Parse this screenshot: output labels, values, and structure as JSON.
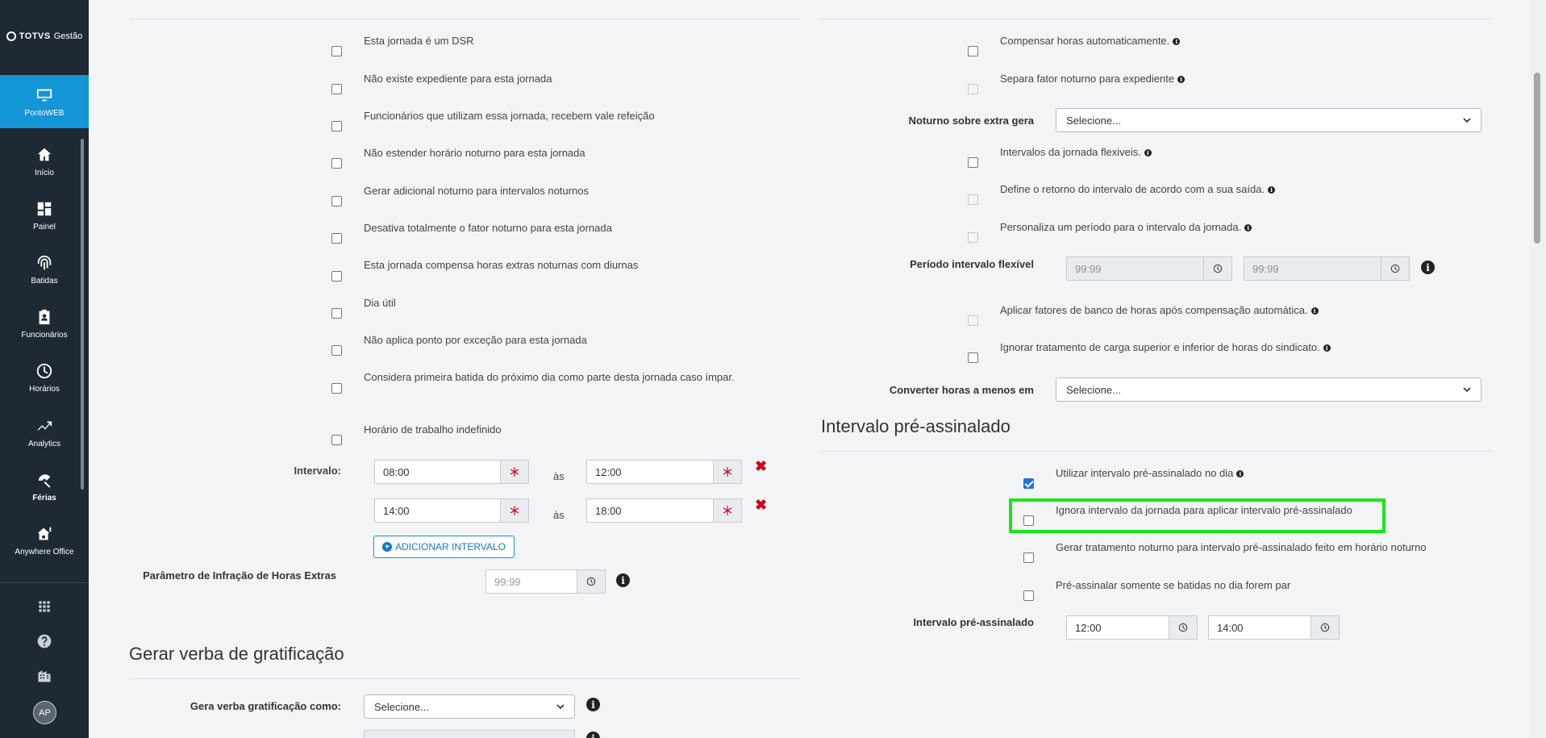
{
  "sidebar": {
    "logo_brand": "TOTVS",
    "logo_product": "Gestão",
    "items": [
      {
        "label": "PontoWEB",
        "icon": "monitor-icon"
      },
      {
        "label": "Início",
        "icon": "home-icon"
      },
      {
        "label": "Painel",
        "icon": "dashboard-icon"
      },
      {
        "label": "Batidas",
        "icon": "fingerprint-icon"
      },
      {
        "label": "Funcionários",
        "icon": "badge-icon"
      },
      {
        "label": "Horários",
        "icon": "clock-icon"
      },
      {
        "label": "Analytics",
        "icon": "trend-icon"
      },
      {
        "label": "Férias",
        "icon": "umbrella-icon"
      },
      {
        "label": "Anywhere Office",
        "icon": "home-office-icon"
      }
    ],
    "avatar_initials": "AP"
  },
  "left": {
    "checkboxes": [
      "Esta jornada é um DSR",
      "Não existe expediente para esta jornada",
      "Funcionários que utilizam essa jornada, recebem vale refeição",
      "Não estender horário noturno para esta jornada",
      "Gerar adicional noturno para intervalos noturnos",
      "Desativa totalmente o fator noturno para esta jornada",
      "Esta jornada compensa horas extras noturnas com diurnas",
      "Dia útil",
      "Não aplica ponto por exceção para esta jornada",
      "Considera primeira batida do próximo dia como parte desta jornada caso ímpar.",
      "Horário de trabalho indefinido"
    ],
    "intervalo_label": "Intervalo:",
    "as_label": "às",
    "intervals": [
      {
        "start": "08:00",
        "end": "12:00"
      },
      {
        "start": "14:00",
        "end": "18:00"
      }
    ],
    "add_interval_label": "ADICIONAR INTERVALO",
    "infracao_label": "Parâmetro de Infração de Horas Extras",
    "infracao_placeholder": "99:99",
    "gratificacao_title": "Gerar verba de gratificação",
    "gera_verba_label": "Gera verba gratificação como:",
    "gera_verba_value": "Selecione..."
  },
  "right": {
    "cb_compensar": "Compensar horas automaticamente.",
    "cb_separa": "Separa fator noturno para expediente",
    "noturno_extra_label": "Noturno sobre extra gera",
    "noturno_extra_value": "Selecione...",
    "cb_flexiveis": "Intervalos da jornada flexiveis.",
    "cb_retorno": "Define o retorno do intervalo de acordo com a sua saída.",
    "cb_personaliza": "Personaliza um período para o intervalo da jornada.",
    "periodo_label": "Período intervalo flexível",
    "periodo_start": "99:99",
    "periodo_end": "99:99",
    "cb_aplicar_fatores": "Aplicar fatores de banco de horas após compensação automática.",
    "cb_ignorar_carga": "Ignorar tratamento de carga superior e inferior de horas do sindicato.",
    "converter_label": "Converter horas a menos em",
    "converter_value": "Selecione...",
    "pre_title": "Intervalo pré-assinalado",
    "cb_utilizar": "Utilizar intervalo pré-assinalado no dia",
    "cb_ignora": "Ignora intervalo da jornada para aplicar intervalo pré-assinalado",
    "cb_gerar_tratamento": "Gerar tratamento noturno para intervalo pré-assinalado feito em horário noturno",
    "cb_pre_par": "Pré-assinalar somente se batidas no dia forem par",
    "pre_label": "Intervalo pré-assinalado",
    "pre_start": "12:00",
    "pre_end": "14:00"
  },
  "colors": {
    "sidebar_bg": "#1f2933",
    "active_item": "#1395d6",
    "highlight": "#19e619",
    "remove": "#d0021b"
  }
}
